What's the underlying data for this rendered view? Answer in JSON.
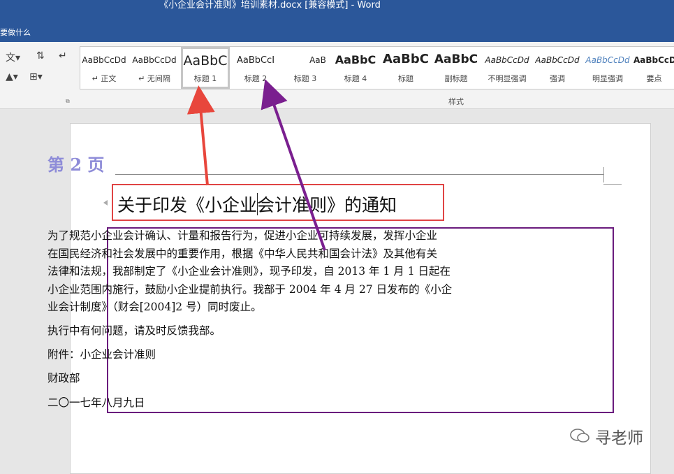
{
  "window": {
    "title": "《小企业会计准则》培训素材.docx [兼容模式]  -  Word",
    "tell_me": "要做什么"
  },
  "styles": {
    "group_label": "样式",
    "items": [
      {
        "preview": "AaBbCcDd",
        "name": "↵ 正文"
      },
      {
        "preview": "AaBbCcDd",
        "name": "↵ 无间隔"
      },
      {
        "preview": "AaBbC",
        "name": "标题 1"
      },
      {
        "preview": "AaBbCcI",
        "name": "标题 2"
      },
      {
        "preview": "AaB",
        "name": "标题 3"
      },
      {
        "preview": "AaBbC",
        "name": "标题 4"
      },
      {
        "preview": "AaBbC",
        "name": "标题"
      },
      {
        "preview": "AaBbC",
        "name": "副标题"
      },
      {
        "preview": "AaBbCcDd",
        "name": "不明显强调"
      },
      {
        "preview": "AaBbCcDd",
        "name": "强调"
      },
      {
        "preview": "AaBbCcDd",
        "name": "明显强调"
      },
      {
        "preview": "AaBbCcDd",
        "name": "要点"
      }
    ],
    "selected": "标题 1"
  },
  "document": {
    "header": "第 2 页",
    "heading": "关于印发《小企业会计准则》的通知",
    "paragraph_lines": [
      "为了规范小企业会计确认、计量和报告行为，促进小企业可持续发展，发挥小企业",
      "在国民经济和社会发展中的重要作用，根据《中华人民共和国会计法》及其他有关",
      "法律和法规，我部制定了《小企业会计准则》，现予印发，自 2013 年 1 月 1 日起在",
      "小企业范围内施行，鼓励小企业提前执行。我部于 2004 年 4 月 27 日发布的《小企",
      "业会计制度》（财会[2004]2 号）同时废止。"
    ],
    "line2": "执行中有何问题，请及时反馈我部。",
    "attachment": "附件：小企业会计准则",
    "issuer": "财政部",
    "date": "二〇一七年八月九日"
  },
  "watermark": "寻老师",
  "colors": {
    "title_bar": "#2b579a",
    "heading_box": "#e04444",
    "body_box": "#6a1b7d",
    "arrow_red": "#e8463c",
    "arrow_purple": "#7a1f8f",
    "header_text": "#8e8cd8"
  }
}
